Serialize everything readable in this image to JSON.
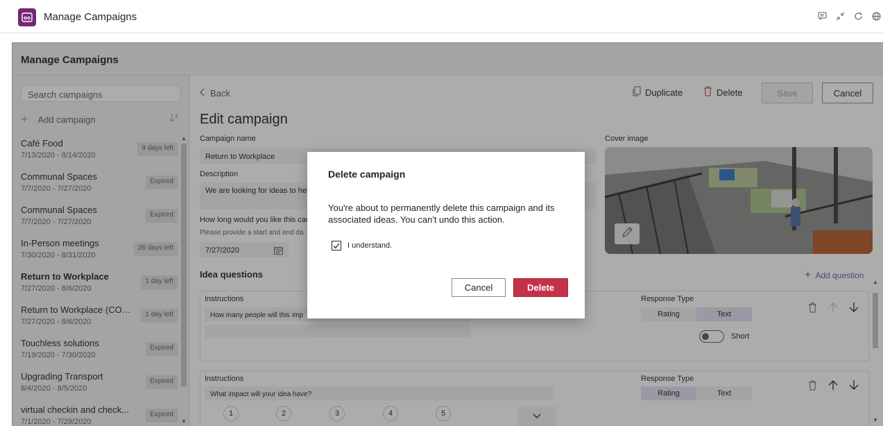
{
  "topbar": {
    "title": "Manage Campaigns",
    "icons": [
      "chat-icon",
      "collapse-icon",
      "refresh-icon",
      "globe-icon"
    ]
  },
  "frame": {
    "title": "Manage Campaigns"
  },
  "left": {
    "search_placeholder": "Search campaigns",
    "add_label": "Add campaign",
    "campaigns": [
      {
        "name": "Café Food",
        "dates": "7/13/2020 - 8/14/2020",
        "badge": "9 days left",
        "bold": false
      },
      {
        "name": "Communal Spaces",
        "dates": "7/7/2020 - 7/27/2020",
        "badge": "Expired",
        "bold": false
      },
      {
        "name": "Communal Spaces",
        "dates": "7/7/2020 - 7/27/2020",
        "badge": "Expired",
        "bold": false
      },
      {
        "name": "In-Person meetings",
        "dates": "7/30/2020 - 8/31/2020",
        "badge": "26 days left",
        "bold": false
      },
      {
        "name": "Return to Workplace",
        "dates": "7/27/2020 - 8/6/2020",
        "badge": "1 day left",
        "bold": true
      },
      {
        "name": "Return to Workplace (COP...",
        "dates": "7/27/2020 - 8/6/2020",
        "badge": "1 day left",
        "bold": false
      },
      {
        "name": "Touchless solutions",
        "dates": "7/19/2020 - 7/30/2020",
        "badge": "Expired",
        "bold": false
      },
      {
        "name": "Upgrading Transport",
        "dates": "8/4/2020 - 8/5/2020",
        "badge": "Expired",
        "bold": false
      },
      {
        "name": "virtual checkin and check...",
        "dates": "7/1/2020 - 7/29/2020",
        "badge": "Expired",
        "bold": false
      }
    ]
  },
  "editor": {
    "back_label": "Back",
    "duplicate_label": "Duplicate",
    "delete_label": "Delete",
    "save_label": "Save",
    "cancel_label": "Cancel",
    "title": "Edit campaign",
    "campaign_name_label": "Campaign name",
    "campaign_name_value": "Return to Workplace",
    "description_label": "Description",
    "description_value": "We are looking for ideas to help",
    "duration_label": "How long would you like this car",
    "duration_hint": "Please provide a start and end da",
    "start_date": "7/27/2020",
    "cover_label": "Cover image",
    "idea_questions_label": "Idea questions",
    "add_question_label": "Add question",
    "questions": [
      {
        "instructions_label": "Instructions",
        "question": "How many people will this imp",
        "response_type_label": "Response Type",
        "types": [
          "Rating",
          "Text"
        ],
        "active": "Text",
        "toggle_label": "Short"
      },
      {
        "instructions_label": "Instructions",
        "question": "What impact will your idea have?",
        "response_type_label": "Response Type",
        "types": [
          "Rating",
          "Text"
        ],
        "active": "Rating",
        "ratings": [
          "1",
          "2",
          "3",
          "4",
          "5"
        ]
      }
    ]
  },
  "dialog": {
    "title": "Delete campaign",
    "message": "You're about to permanently delete this campaign and its associated ideas. You can't undo this action.",
    "checkbox_label": "I understand.",
    "checkbox_checked": true,
    "cancel_label": "Cancel",
    "delete_label": "Delete"
  },
  "colors": {
    "brand": "#742774",
    "accent": "#6264a7",
    "danger": "#c4314b"
  }
}
